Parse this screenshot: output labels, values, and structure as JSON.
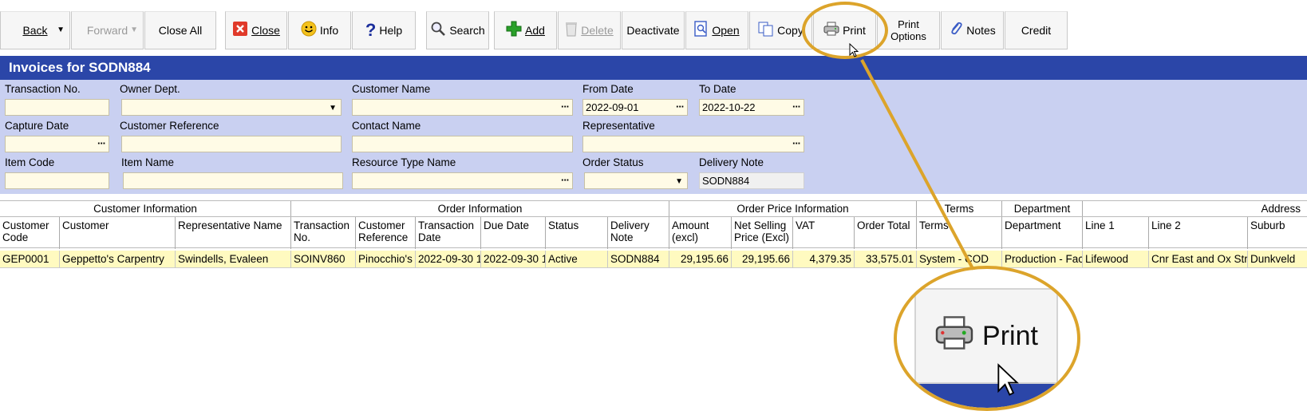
{
  "toolbar": {
    "back": "Back",
    "forward": "Forward",
    "close_all": "Close All",
    "close": "Close",
    "info": "Info",
    "help": "Help",
    "search": "Search",
    "add": "Add",
    "delete": "Delete",
    "deactivate": "Deactivate",
    "open": "Open",
    "copy": "Copy",
    "print": "Print",
    "print_options_1": "Print",
    "print_options_2": "Options",
    "notes": "Notes",
    "credit": "Credit"
  },
  "title": "Invoices for SODN884",
  "filters": {
    "transaction_no": {
      "label": "Transaction No.",
      "value": ""
    },
    "owner_dept": {
      "label": "Owner Dept.",
      "value": ""
    },
    "customer_name": {
      "label": "Customer Name",
      "value": ""
    },
    "from_date": {
      "label": "From Date",
      "value": "2022-09-01"
    },
    "to_date": {
      "label": "To Date",
      "value": "2022-10-22"
    },
    "capture_date": {
      "label": "Capture Date",
      "value": ""
    },
    "customer_reference": {
      "label": "Customer Reference",
      "value": ""
    },
    "contact_name": {
      "label": "Contact Name",
      "value": ""
    },
    "representative": {
      "label": "Representative",
      "value": ""
    },
    "item_code": {
      "label": "Item Code",
      "value": ""
    },
    "item_name": {
      "label": "Item Name",
      "value": ""
    },
    "resource_type_name": {
      "label": "Resource Type Name",
      "value": ""
    },
    "order_status": {
      "label": "Order Status",
      "value": ""
    },
    "delivery_note": {
      "label": "Delivery Note",
      "value": "SODN884"
    }
  },
  "grid": {
    "groups": {
      "customer_info": "Customer Information",
      "order_info": "Order Information",
      "order_price_info": "Order Price Information",
      "terms": "Terms",
      "department": "Department",
      "address": "Address"
    },
    "columns": {
      "customer_code_1": "Customer",
      "customer_code_2": "Code",
      "customer": "Customer",
      "representative_name": "Representative Name",
      "transaction_no_1": "Transaction",
      "transaction_no_2": "No.",
      "customer_reference_1": "Customer",
      "customer_reference_2": "Reference",
      "transaction_date_1": "Transaction",
      "transaction_date_2": "Date",
      "due_date": "Due Date",
      "status": "Status",
      "delivery_note_1": "Delivery",
      "delivery_note_2": "Note",
      "amount_excl_1": "Amount",
      "amount_excl_2": "(excl)",
      "net_selling_1": "Net Selling",
      "net_selling_2": "Price (Excl)",
      "vat": "VAT",
      "order_total": "Order Total",
      "terms": "Terms",
      "department": "Department",
      "line1": "Line 1",
      "line2": "Line 2",
      "suburb": "Suburb"
    },
    "row": {
      "customer_code": "GEP0001",
      "customer": "Geppetto's Carpentry",
      "representative_name": "Swindells, Evaleen",
      "transaction_no": "SOINV860",
      "customer_reference": "Pinocchio's",
      "transaction_date": "2022-09-30 1",
      "due_date": "2022-09-30 1",
      "status": "Active",
      "delivery_note": "SODN884",
      "amount_excl": "29,195.66",
      "net_selling": "29,195.66",
      "vat": "4,379.35",
      "order_total": "33,575.01",
      "terms": "System - COD",
      "department": "Production - Fac",
      "line1": "Lifewood",
      "line2": "Cnr East and Ox Str",
      "suburb": "Dunkveld"
    }
  },
  "callout": {
    "zoom_label": "Print",
    "color": "#dca42b"
  },
  "colors": {
    "titlebar": "#2b46a8",
    "filter_panel": "#c9d0f1",
    "field_bg": "#fffbe6",
    "selected_row": "#fffac0"
  }
}
